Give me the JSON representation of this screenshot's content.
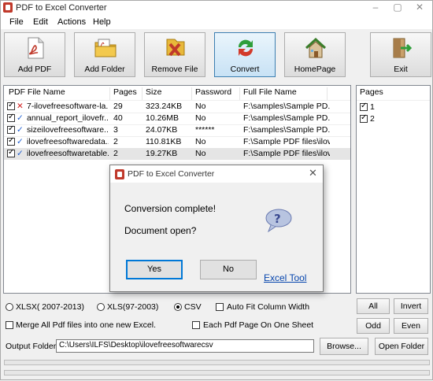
{
  "window": {
    "title": "PDF to Excel Converter"
  },
  "menu": [
    "File",
    "Edit",
    "Actions",
    "Help"
  ],
  "toolbar": {
    "add_pdf": "Add PDF",
    "add_folder": "Add Folder",
    "remove_file": "Remove File",
    "convert": "Convert",
    "homepage": "HomePage",
    "exit": "Exit"
  },
  "table": {
    "columns": [
      "PDF File Name",
      "Pages",
      "Size",
      "Password",
      "Full File Name"
    ],
    "rows": [
      {
        "checked": true,
        "status": "✕",
        "name": "7-ilovefreesoftware-la...",
        "pages": "29",
        "size": "323.24KB",
        "password": "No",
        "full": "F:\\samples\\Sample PD..."
      },
      {
        "checked": true,
        "status": "✓",
        "name": "annual_report_ilovefr...",
        "pages": "40",
        "size": "10.26MB",
        "password": "No",
        "full": "F:\\samples\\Sample PD..."
      },
      {
        "checked": true,
        "status": "✓",
        "name": "sizeilovefreesoftware....",
        "pages": "3",
        "size": "24.07KB",
        "password": "******",
        "full": "F:\\samples\\Sample PD..."
      },
      {
        "checked": true,
        "status": "✓",
        "name": "ilovefreesoftwaredata...",
        "pages": "2",
        "size": "110.81KB",
        "password": "No",
        "full": "F:\\Sample PDF files\\ilov..."
      },
      {
        "checked": true,
        "status": "✓",
        "name": "ilovefreesoftwaretable...",
        "pages": "2",
        "size": "19.27KB",
        "password": "No",
        "full": "F:\\Sample PDF files\\ilov..."
      }
    ]
  },
  "pages_panel": {
    "header": "Pages",
    "items": [
      "1",
      "2"
    ]
  },
  "options": {
    "xlsx": "XLSX( 2007-2013)",
    "xls": "XLS(97-2003)",
    "csv": "CSV",
    "autofit": "Auto Fit Column Width",
    "merge": "Merge All Pdf files into one new Excel.",
    "each_page": "Each Pdf Page On One Sheet",
    "output_label": "Output Folder:",
    "output_value": "C:\\Users\\ILFS\\Desktop\\ilovefreesoftwarecsv",
    "browse": "Browse...",
    "open_folder": "Open Folder",
    "all": "All",
    "invert": "Invert",
    "odd": "Odd",
    "even": "Even"
  },
  "dialog": {
    "title": "PDF to Excel Converter",
    "line1": "Conversion complete!",
    "line2": "Document open?",
    "yes": "Yes",
    "no": "No",
    "link": "Excel Tool"
  },
  "colors": {
    "accent": "#0078d7",
    "link": "#0645ad",
    "error": "#d21f1f",
    "ok": "#1f5fd2"
  }
}
